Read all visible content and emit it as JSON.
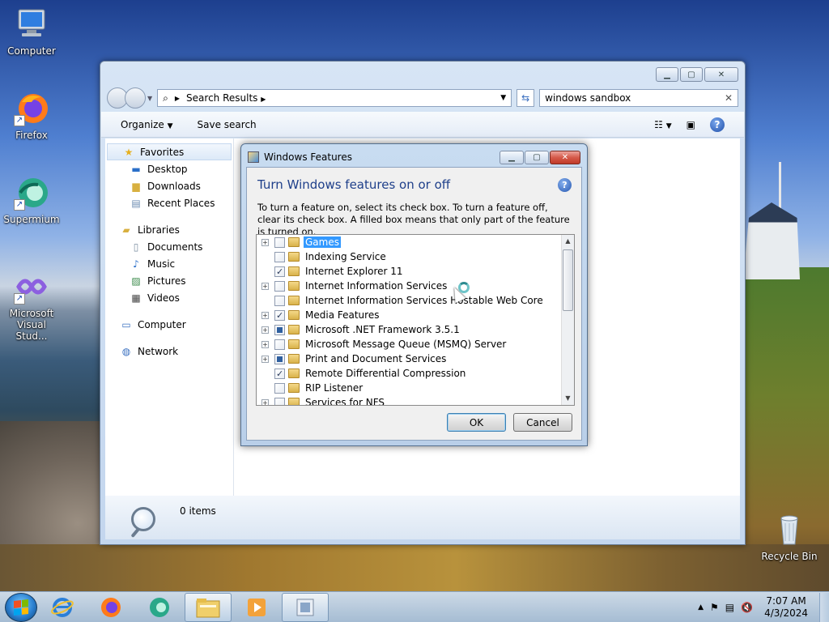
{
  "desktop": {
    "icons": [
      {
        "label": "Computer"
      },
      {
        "label": "Firefox"
      },
      {
        "label": "Supermium"
      },
      {
        "label": "Microsoft Visual Stud..."
      },
      {
        "label": "Recycle Bin"
      }
    ]
  },
  "explorer": {
    "address": "Search Results",
    "search_value": "windows sandbox",
    "toolbar": {
      "organize": "Organize",
      "save_search": "Save search"
    },
    "nav": {
      "favorites": "Favorites",
      "favorites_items": [
        "Desktop",
        "Downloads",
        "Recent Places"
      ],
      "libraries": "Libraries",
      "libraries_items": [
        "Documents",
        "Music",
        "Pictures",
        "Videos"
      ],
      "computer": "Computer",
      "network": "Network"
    },
    "status": "0 items"
  },
  "dialog": {
    "title": "Windows Features",
    "heading": "Turn Windows features on or off",
    "description": "To turn a feature on, select its check box. To turn a feature off, clear its check box. A filled box means that only part of the feature is turned on.",
    "features": [
      {
        "name": "Games",
        "state": "unchecked",
        "expandable": true,
        "selected": true
      },
      {
        "name": "Indexing Service",
        "state": "unchecked",
        "expandable": false
      },
      {
        "name": "Internet Explorer 11",
        "state": "checked",
        "expandable": false
      },
      {
        "name": "Internet Information Services",
        "state": "unchecked",
        "expandable": true
      },
      {
        "name": "Internet Information Services Hostable Web Core",
        "state": "unchecked",
        "expandable": false
      },
      {
        "name": "Media Features",
        "state": "checked",
        "expandable": true
      },
      {
        "name": "Microsoft .NET Framework 3.5.1",
        "state": "partial",
        "expandable": true
      },
      {
        "name": "Microsoft Message Queue (MSMQ) Server",
        "state": "unchecked",
        "expandable": true
      },
      {
        "name": "Print and Document Services",
        "state": "partial",
        "expandable": true
      },
      {
        "name": "Remote Differential Compression",
        "state": "checked",
        "expandable": false
      },
      {
        "name": "RIP Listener",
        "state": "unchecked",
        "expandable": false
      },
      {
        "name": "Services for NFS",
        "state": "unchecked",
        "expandable": true
      }
    ],
    "ok": "OK",
    "cancel": "Cancel"
  },
  "taskbar": {
    "time": "7:07 AM",
    "date": "4/3/2024"
  }
}
